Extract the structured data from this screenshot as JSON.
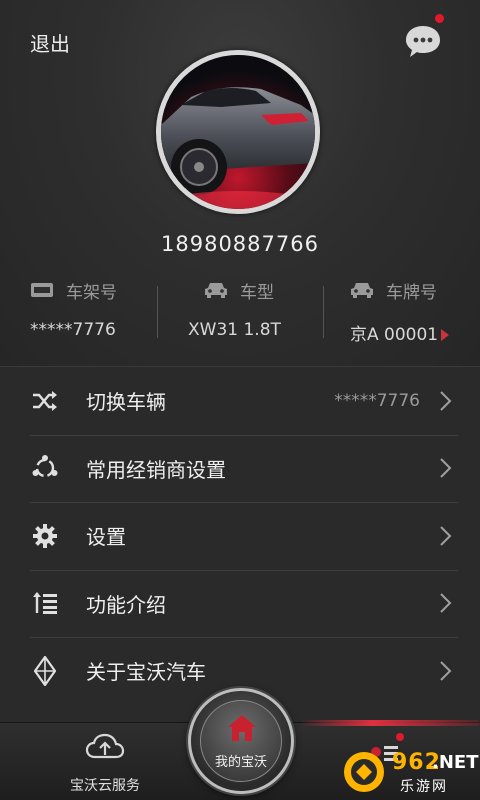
{
  "header": {
    "logout_label": "退出"
  },
  "profile": {
    "phone": "18980887766"
  },
  "vehicle_info": [
    {
      "label": "车架号",
      "value": "*****7776",
      "icon": "vin-plate-icon"
    },
    {
      "label": "车型",
      "value": "XW31 1.8T",
      "icon": "car-front-icon"
    },
    {
      "label": "车牌号",
      "value": "京A 00001",
      "icon": "car-front-icon"
    }
  ],
  "menu": [
    {
      "label": "切换车辆",
      "value": "*****7776",
      "icon": "shuffle-icon"
    },
    {
      "label": "常用经销商设置",
      "value": "",
      "icon": "network-icon"
    },
    {
      "label": "设置",
      "value": "",
      "icon": "gear-icon"
    },
    {
      "label": "功能介绍",
      "value": "",
      "icon": "list-icon"
    },
    {
      "label": "关于宝沃汽车",
      "value": "",
      "icon": "logo-diamond-icon"
    }
  ],
  "tabbar": {
    "left_label": "宝沃云服务",
    "center_label": "我的宝沃"
  },
  "watermark": {
    "number": "962",
    "suffix": ".NET",
    "text": "乐游网"
  },
  "colors": {
    "accent_red": "#e01a2b",
    "background": "#242424"
  }
}
